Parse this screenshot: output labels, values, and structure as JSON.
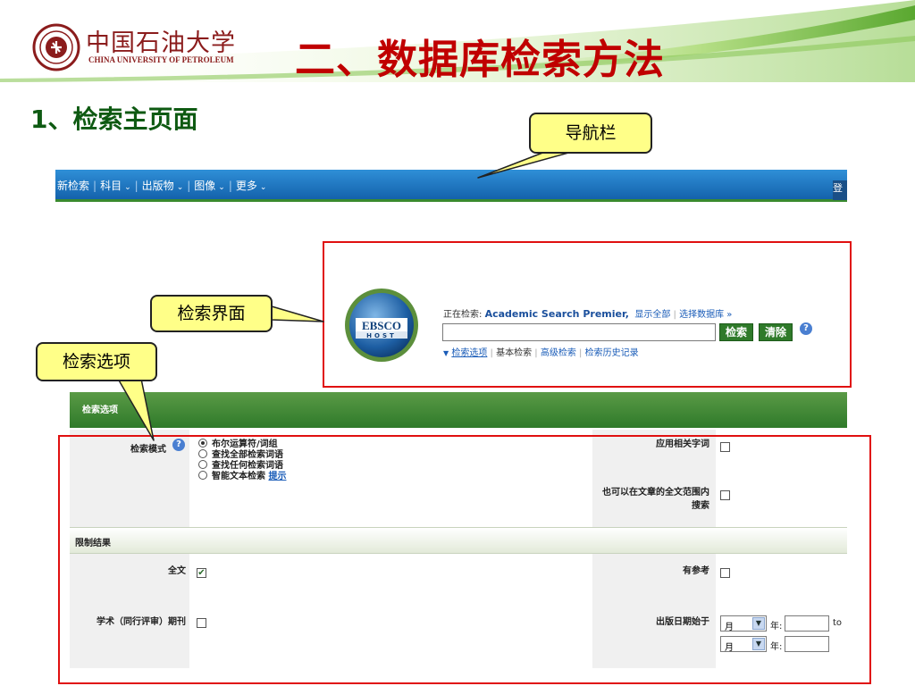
{
  "header": {
    "logo_cn": "中国石油大学",
    "logo_en": "CHINA UNIVERSITY OF PETROLEUM",
    "title": "二、数据库检索方法",
    "colors": {
      "title": "#c00000",
      "brand": "#8b1c1c",
      "accent_green": "#6cb33f"
    }
  },
  "subtitle": "1、检索主页面",
  "callouts": {
    "nav": "导航栏",
    "search_ui": "检索界面",
    "options": "检索选项"
  },
  "navbar": {
    "items": [
      {
        "label": "新检索",
        "dropdown": false
      },
      {
        "label": "科目",
        "dropdown": true
      },
      {
        "label": "出版物",
        "dropdown": true
      },
      {
        "label": "图像",
        "dropdown": true
      },
      {
        "label": "更多",
        "dropdown": true
      }
    ],
    "right_label": "登"
  },
  "search": {
    "logo_text": "EBSCO",
    "logo_sub": "HOST",
    "searching_label": "正在检索:",
    "database": "Academic Search Premier,",
    "show_all": "显示全部",
    "select_db": "选择数据库 »",
    "search_button": "检索",
    "clear_button": "清除",
    "help": "?",
    "links": [
      "检索选项",
      "基本检索",
      "高级检索",
      "检索历史记录"
    ]
  },
  "options": {
    "header": "检索选项",
    "search_mode_label": "检索模式",
    "modes": [
      {
        "label": "布尔运算符/词组",
        "selected": true
      },
      {
        "label": "查找全部检索词语",
        "selected": false
      },
      {
        "label": "查找任何检索词语",
        "selected": false
      },
      {
        "label": "智能文本检索",
        "selected": false
      }
    ],
    "hint_link": "提示",
    "apply_related": "应用相关字词",
    "fulltext_search": "也可以在文章的全文范围内搜索",
    "limit_header": "限制结果",
    "fulltext_label": "全文",
    "fulltext_checked": true,
    "references_label": "有参考",
    "scholarly_label": "学术（同行评审）期刊",
    "pubdate_label": "出版日期始于",
    "month_placeholder": "月",
    "year_label": "年:",
    "to_label": "to"
  }
}
